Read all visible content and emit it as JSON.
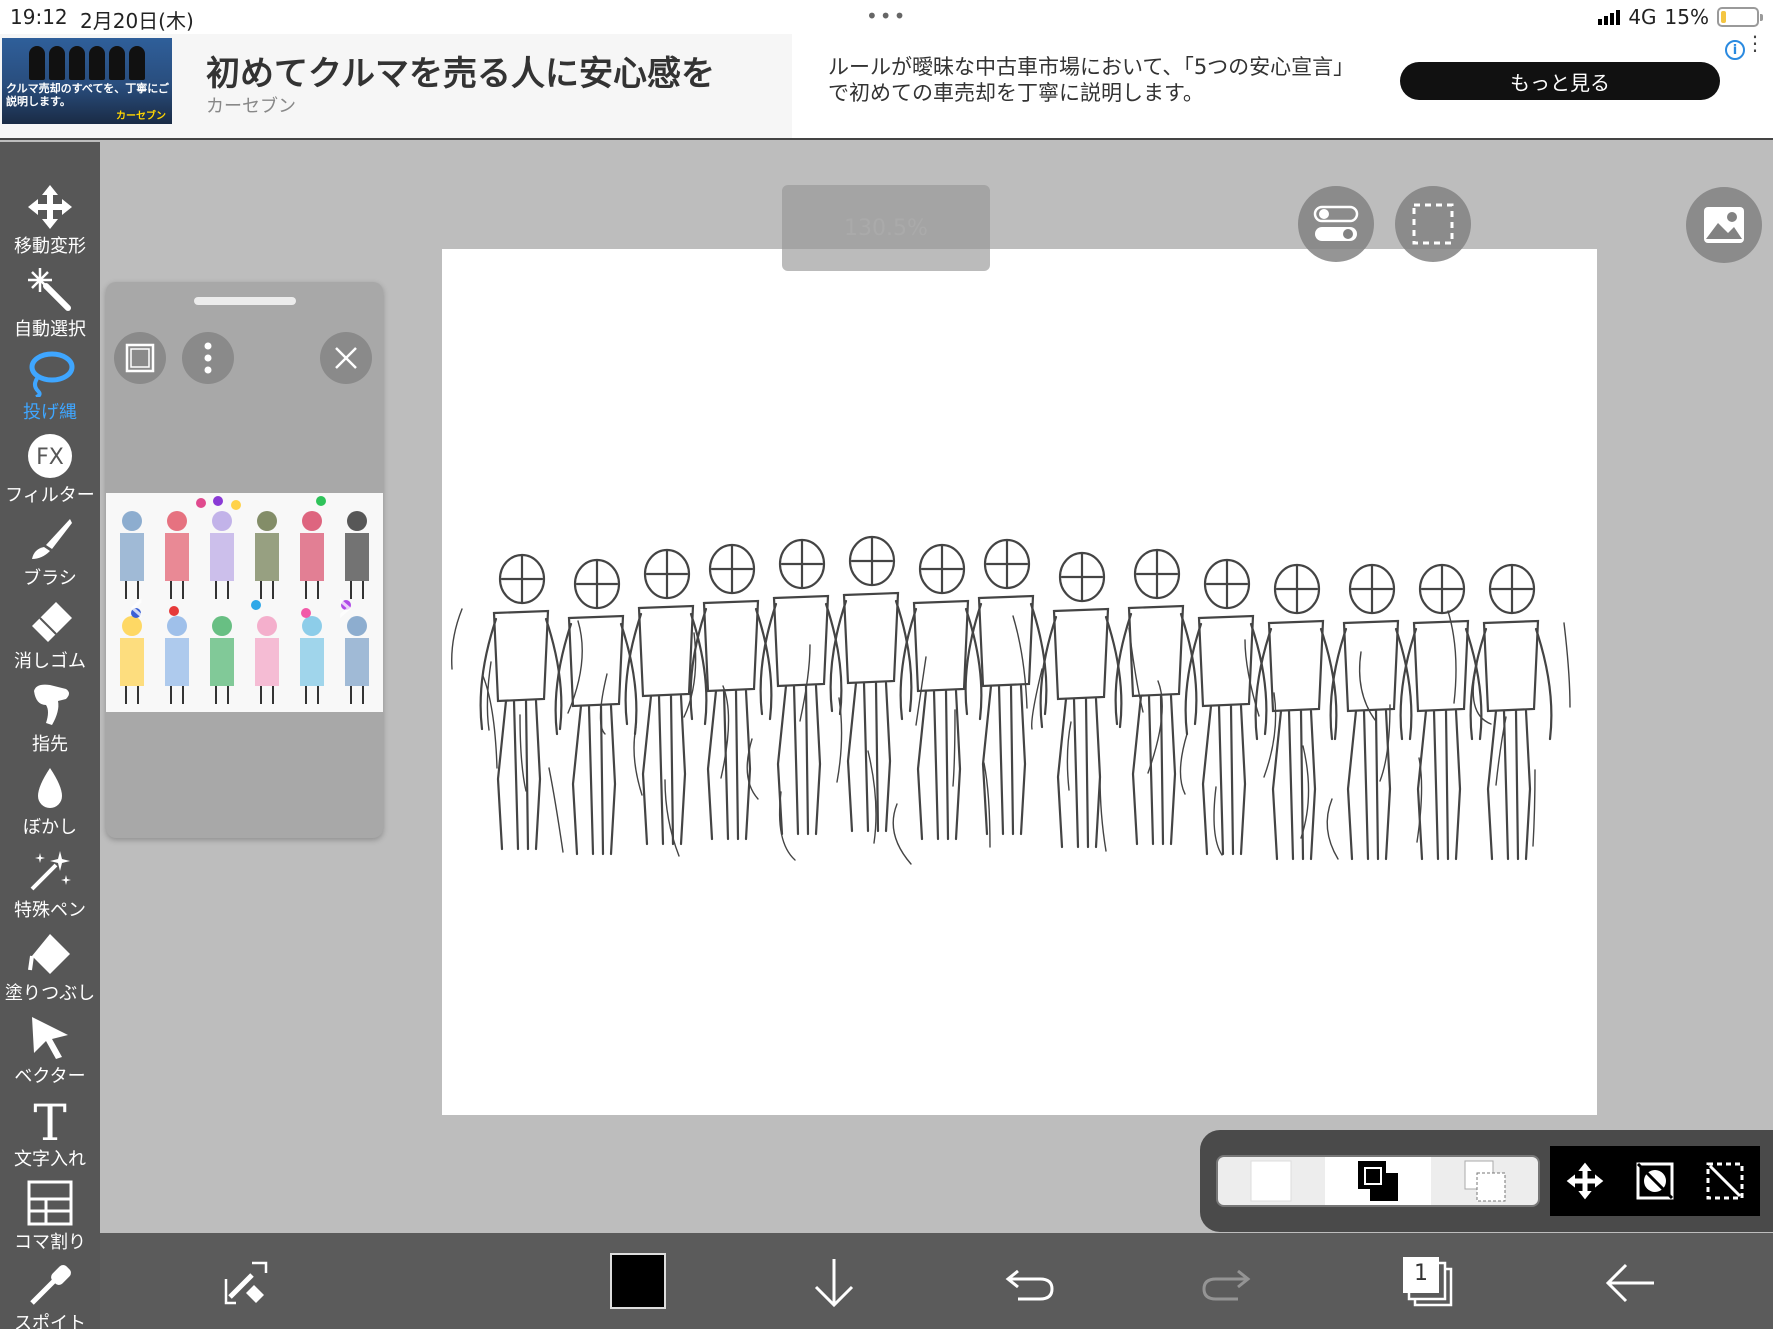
{
  "status_bar": {
    "time": "19:12",
    "date": "2月20日(木)",
    "network": "4G",
    "battery": "15%",
    "battery_level": 0.15,
    "dots": "•••"
  },
  "ad": {
    "thumb_text": "クルマ売却のすべてを、丁寧にご説明します。",
    "thumb_brand": "カーセブン",
    "headline": "初めてクルマを売る人に安心感を",
    "advertiser": "カーセブン",
    "description": "ルールが曖昧な中古車市場において、「5つの安心宣言」で初めての車売却を丁寧に説明します。",
    "cta": "もっと見る",
    "info_icon": "i"
  },
  "toolbar": {
    "tools": [
      {
        "name": "move-transform",
        "label": "移動変形",
        "icon": "move-icon",
        "active": false
      },
      {
        "name": "auto-select",
        "label": "自動選択",
        "icon": "magic-wand-icon",
        "active": false
      },
      {
        "name": "lasso",
        "label": "投げ縄",
        "icon": "lasso-icon",
        "active": true
      },
      {
        "name": "filter",
        "label": "フィルター",
        "icon": "fx-icon",
        "active": false
      },
      {
        "name": "brush",
        "label": "ブラシ",
        "icon": "brush-icon",
        "active": false
      },
      {
        "name": "eraser",
        "label": "消しゴム",
        "icon": "eraser-icon",
        "active": false
      },
      {
        "name": "finger",
        "label": "指先",
        "icon": "finger-icon",
        "active": false
      },
      {
        "name": "blur",
        "label": "ぼかし",
        "icon": "drop-icon",
        "active": false
      },
      {
        "name": "special-pen",
        "label": "特殊ペン",
        "icon": "sparkle-pen-icon",
        "active": false
      },
      {
        "name": "fill",
        "label": "塗りつぶし",
        "icon": "bucket-icon",
        "active": false
      },
      {
        "name": "vector",
        "label": "ベクター",
        "icon": "cursor-icon",
        "active": false
      },
      {
        "name": "text",
        "label": "文字入れ",
        "icon": "text-icon",
        "active": false
      },
      {
        "name": "frame-divide",
        "label": "コマ割り",
        "icon": "panel-icon",
        "active": false
      },
      {
        "name": "eyedropper",
        "label": "スポイト",
        "icon": "eyedropper-icon",
        "active": false
      }
    ],
    "active_color": "#3fa6ff"
  },
  "canvas": {
    "zoom_label": "130.5%"
  },
  "material_panel": {
    "prev_arrow": "‹",
    "next_arrow": "›"
  },
  "bottom_bar": {
    "layer_count": "1",
    "current_color": "#000000"
  }
}
